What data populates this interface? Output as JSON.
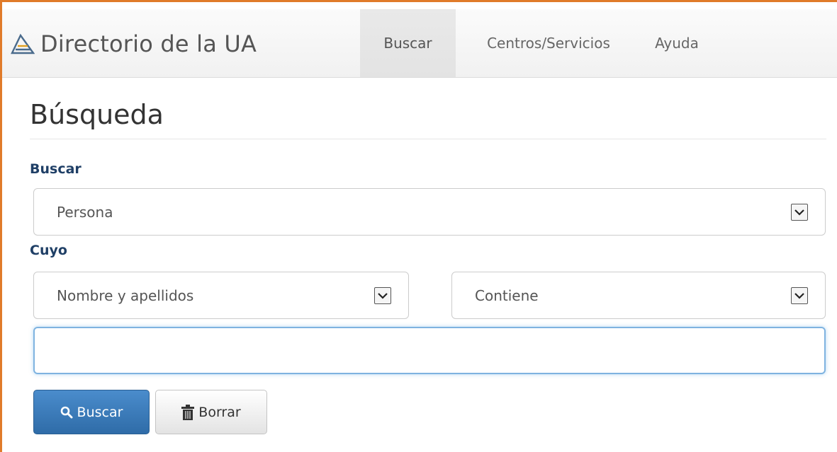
{
  "navbar": {
    "brand": "Directorio de la UA",
    "tabs": [
      {
        "label": "Buscar",
        "active": true
      },
      {
        "label": "Centros/Servicios",
        "active": false
      },
      {
        "label": "Ayuda",
        "active": false
      }
    ]
  },
  "page": {
    "title": "Búsqueda"
  },
  "form": {
    "buscar_label": "Buscar",
    "buscar_select": "Persona",
    "cuyo_label": "Cuyo",
    "field_select": "Nombre y apellidos",
    "condition_select": "Contiene",
    "query_value": "",
    "submit_label": "Buscar",
    "clear_label": "Borrar"
  },
  "colors": {
    "accent_frame": "#e07b2a",
    "primary_button": "#3a7cbd",
    "label_text": "#1f3f66"
  },
  "icons": {
    "brand": "ua-logo-icon",
    "submit": "search-icon",
    "clear": "trash-icon",
    "select": "chevron-down-icon"
  }
}
